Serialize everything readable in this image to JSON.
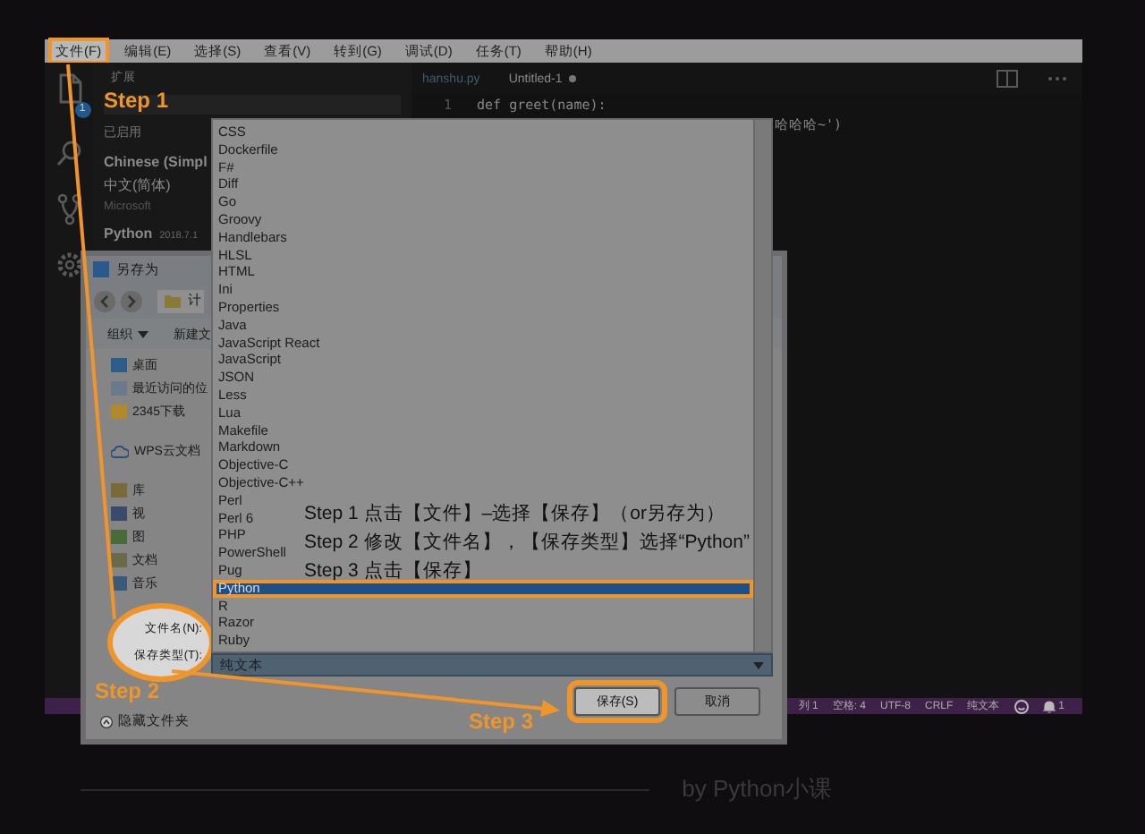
{
  "menu_bar": [
    {
      "label": "文件(F)",
      "highlighted": true
    },
    {
      "label": "编辑(E)",
      "highlighted": false
    },
    {
      "label": "选择(S)",
      "highlighted": false
    },
    {
      "label": "查看(V)",
      "highlighted": false
    },
    {
      "label": "转到(G)",
      "highlighted": false
    },
    {
      "label": "调试(D)",
      "highlighted": false
    },
    {
      "label": "任务(T)",
      "highlighted": false
    },
    {
      "label": "帮助(H)",
      "highlighted": false
    }
  ],
  "activity_bar": {
    "badge": "1"
  },
  "sidebar": {
    "title": "扩展",
    "section": "已启用",
    "extensions": [
      {
        "name": "Chinese (Simpl",
        "description": "中文(简体)",
        "publisher": "Microsoft"
      },
      {
        "name": "Python",
        "version": "2018.7.1"
      }
    ]
  },
  "editor": {
    "tabs": [
      {
        "label": "hanshu.py",
        "selected": false,
        "modified": false
      },
      {
        "label": "Untitled-1",
        "selected": true,
        "modified": true
      }
    ],
    "lines": [
      {
        "kind": "code",
        "number": "1",
        "code": "def greet(name):"
      },
      {
        "kind": "fragment",
        "code": "哈哈哈~')"
      }
    ]
  },
  "status_bar": {
    "items": [
      "列 1",
      "空格: 4",
      "UTF-8",
      "CRLF",
      "纯文本"
    ],
    "notifications": "1"
  },
  "save_dialog": {
    "title": "另存为",
    "path": "计",
    "toolbar": [
      {
        "label": "组织",
        "dropdown": true
      },
      {
        "label": "新建文",
        "dropdown": false
      }
    ],
    "nav_groups": [
      [
        {
          "kind": "desktop",
          "label": "桌面"
        },
        {
          "kind": "recent",
          "label": "最近访问的位"
        },
        {
          "kind": "download",
          "label": "2345下载"
        }
      ],
      [
        {
          "kind": "cloud",
          "label": "WPS云文档"
        }
      ],
      [
        {
          "kind": "library",
          "label": "库"
        },
        {
          "kind": "video",
          "label": "视"
        },
        {
          "kind": "picture",
          "label": "图"
        },
        {
          "kind": "document",
          "label": "文档"
        },
        {
          "kind": "music",
          "label": "音乐"
        }
      ]
    ],
    "file_name_label": "文件名(N):",
    "file_type_label": "保存类型(T):",
    "file_type_value": "纯文本",
    "hide_folders": "隐藏文件夹",
    "buttons": [
      {
        "label": "保存(S)",
        "highlighted": true
      },
      {
        "label": "取消",
        "highlighted": false
      }
    ]
  },
  "type_list": [
    {
      "label": "CSS",
      "selected": false,
      "highlighted": false
    },
    {
      "label": "Dockerfile",
      "selected": false,
      "highlighted": false
    },
    {
      "label": "F#",
      "selected": false,
      "highlighted": false
    },
    {
      "label": "Diff",
      "selected": false,
      "highlighted": false
    },
    {
      "label": "Go",
      "selected": false,
      "highlighted": false
    },
    {
      "label": "Groovy",
      "selected": false,
      "highlighted": false
    },
    {
      "label": "Handlebars",
      "selected": false,
      "highlighted": false
    },
    {
      "label": "HLSL",
      "selected": false,
      "highlighted": false
    },
    {
      "label": "HTML",
      "selected": false,
      "highlighted": false
    },
    {
      "label": "Ini",
      "selected": false,
      "highlighted": false
    },
    {
      "label": "Properties",
      "selected": false,
      "highlighted": false
    },
    {
      "label": "Java",
      "selected": false,
      "highlighted": false
    },
    {
      "label": "JavaScript React",
      "selected": false,
      "highlighted": false
    },
    {
      "label": "JavaScript",
      "selected": false,
      "highlighted": false
    },
    {
      "label": "JSON",
      "selected": false,
      "highlighted": false
    },
    {
      "label": "Less",
      "selected": false,
      "highlighted": false
    },
    {
      "label": "Lua",
      "selected": false,
      "highlighted": false
    },
    {
      "label": "Makefile",
      "selected": false,
      "highlighted": false
    },
    {
      "label": "Markdown",
      "selected": false,
      "highlighted": false
    },
    {
      "label": "Objective-C",
      "selected": false,
      "highlighted": false
    },
    {
      "label": "Objective-C++",
      "selected": false,
      "highlighted": false
    },
    {
      "label": "Perl",
      "selected": false,
      "highlighted": false
    },
    {
      "label": "Perl 6",
      "selected": false,
      "highlighted": false
    },
    {
      "label": "PHP",
      "selected": false,
      "highlighted": false
    },
    {
      "label": "PowerShell",
      "selected": false,
      "highlighted": false
    },
    {
      "label": "Pug",
      "selected": false,
      "highlighted": false
    },
    {
      "label": "Python",
      "selected": true,
      "highlighted": true
    },
    {
      "label": "R",
      "selected": false,
      "highlighted": false
    },
    {
      "label": "Razor",
      "selected": false,
      "highlighted": false
    },
    {
      "label": "Ruby",
      "selected": false,
      "highlighted": false
    }
  ],
  "annotations": {
    "steps": [
      "Step 1",
      "Step 2",
      "Step 3"
    ],
    "instructions": [
      "Step 1 点击【文件】–选择【保存】（or另存为）",
      "Step 2 修改【文件名】，【保存类型】选择“Python”",
      "Step 3 点击【保存】"
    ]
  },
  "caption": "by Python小课"
}
